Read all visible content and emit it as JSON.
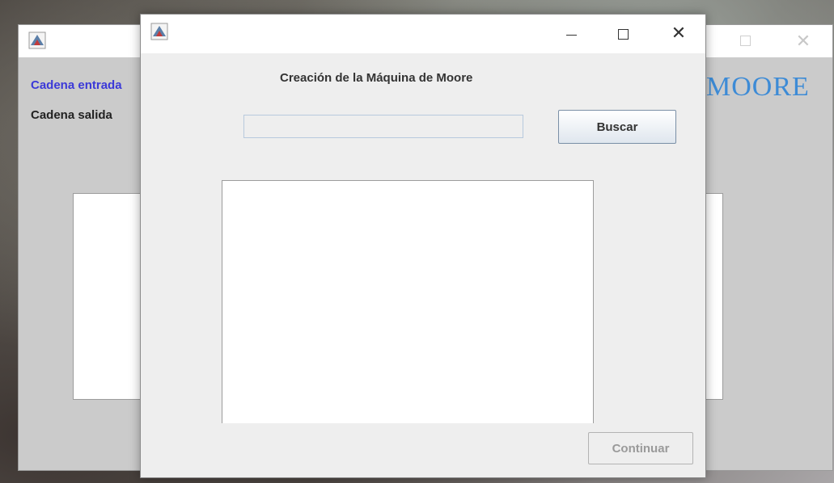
{
  "background_window": {
    "label_entrada": "Cadena entrada",
    "label_salida": "Cadena salida",
    "title_partial": "MOORE",
    "title_color": "#3d8bd6",
    "entrada_color": "#3b39d8",
    "icons": {
      "app": "java-app-icon",
      "maximize": "maximize-icon",
      "close": "close-icon"
    }
  },
  "dialog": {
    "heading": "Creación de la Máquina de Moore",
    "search_input": {
      "value": ""
    },
    "buscar_label": "Buscar",
    "textarea": {
      "value": ""
    },
    "continuar_label": "Continuar",
    "continuar_enabled": false,
    "icons": {
      "app": "java-app-icon",
      "minimize": "minimize-icon",
      "maximize": "maximize-icon",
      "close": "close-icon"
    },
    "close_glyph": "✕"
  }
}
